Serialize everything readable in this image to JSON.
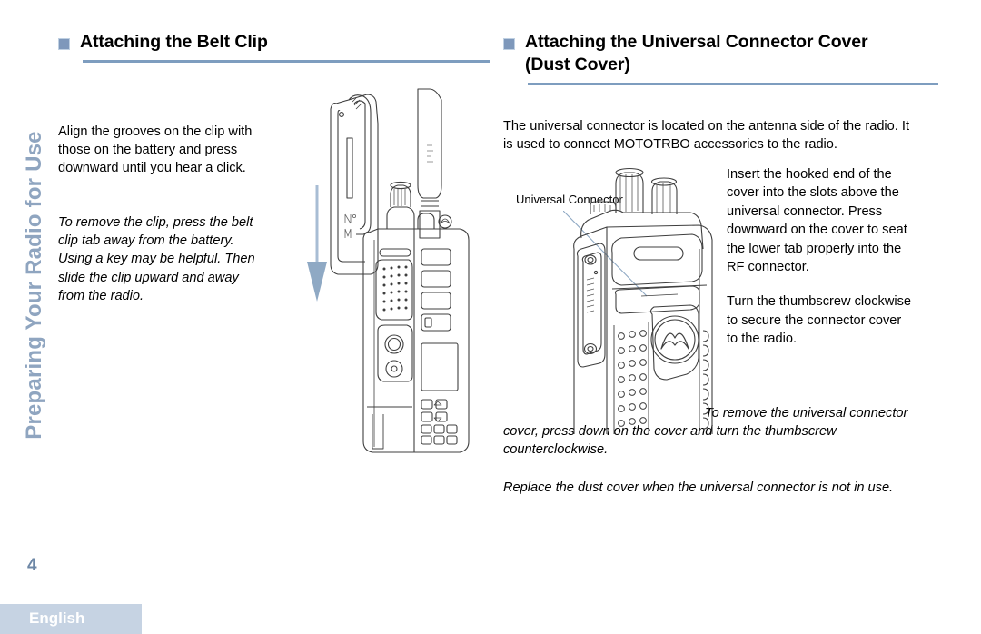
{
  "chapter_tab": {
    "label": "Preparing Your Radio for Use",
    "color": "#8fa5c0"
  },
  "footer": {
    "page_number": "4",
    "language": "English",
    "bar_color": "#c6d3e3"
  },
  "theme": {
    "accent": "#7e9dbf",
    "bullet": "#7e98bb",
    "arrow": "#8fa9c4",
    "line_art": "#3a3a3a"
  },
  "left_column": {
    "heading": "Attaching the Belt Clip",
    "lead_paragraph": "Align the grooves on the clip with those on the battery and press downward until you hear a click.",
    "note_paragraph": "To remove the clip, press the belt clip tab away from the battery. Using a key may be helpful. Then slide the clip upward and away from the radio.",
    "illustration_name": "belt-clip-radio-diagram"
  },
  "right_column": {
    "heading": "Attaching the Universal Connector Cover (Dust Cover)",
    "lead_paragraph": "The universal connector is located on the antenna side of the radio. It is used to connect MOTOTRBO accessories to the radio.",
    "steps": [
      "Insert the hooked end of the cover into the slots above the universal connector. Press downward on the cover to seat the lower tab properly into the RF connector.",
      "Turn the thumbscrew clockwise to secure the connector cover to the radio."
    ],
    "note_paragraph_1": "To remove the universal connector cover, press down on the cover and turn the thumbscrew counterclockwise.",
    "note_paragraph_2": "Replace the dust cover when the universal connector is not in use.",
    "callout_label": "Universal Connector",
    "illustration_name": "universal-connector-radio-diagram"
  }
}
